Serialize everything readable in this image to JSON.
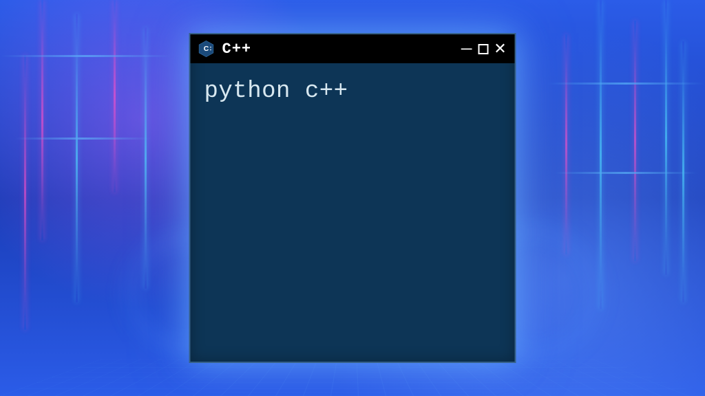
{
  "window": {
    "title": "C++",
    "icon_name": "cpp-logo-icon"
  },
  "terminal": {
    "content": "python c++"
  },
  "colors": {
    "terminal_bg": "#0d3556",
    "titlebar_bg": "#000000",
    "text": "#d8e8f0"
  }
}
